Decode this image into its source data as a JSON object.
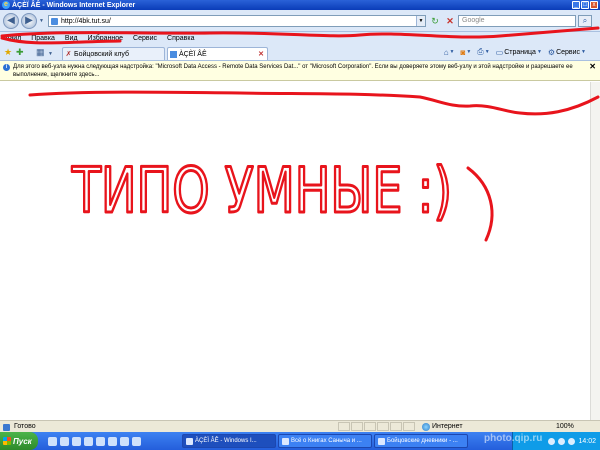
{
  "window": {
    "title": "ÀÇÈÏ ÂÊ - Windows Internet Explorer",
    "controls": [
      "_",
      "□",
      "x"
    ]
  },
  "address": {
    "url": "http://4bk.tut.su/",
    "search_placeholder": "Google"
  },
  "menu": {
    "items": [
      "Файл",
      "Правка",
      "Вид",
      "Избранное",
      "Сервис",
      "Справка"
    ]
  },
  "tabs": [
    {
      "label": "Бойцовский клуб",
      "active": false
    },
    {
      "label": "ÀÇÈÏ ÂÊ",
      "active": true
    }
  ],
  "commandbar": {
    "page_label": "Страница",
    "tools_label": "Сервис"
  },
  "infobar": {
    "text": "Для этого веб-узла нужна следующая надстройка: \"Microsoft Data Access - Remote Data Services Dat...\" от \"Microsoft Corporation\". Если вы доверяете этому веб-узлу и этой надстройке и разрешаете ее выполнение, щелкните здесь..."
  },
  "content": {
    "handwritten_text": "ТИПО УМНЫЕ :)",
    "ink_color": "#e8141c"
  },
  "status": {
    "ready": "Готово",
    "zone": "Интернет",
    "zoom": "100%"
  },
  "taskbar": {
    "start_label": "Пуск",
    "buttons": [
      {
        "label": "ÀÇÈÏ ÂÊ - Windows I...",
        "active": true
      },
      {
        "label": "Всё о Книгах Саныча и ...",
        "active": false
      },
      {
        "label": "Бойцовские дневники - ...",
        "active": false
      }
    ],
    "clock": "14:02"
  },
  "watermark": "photo.qip.ru"
}
